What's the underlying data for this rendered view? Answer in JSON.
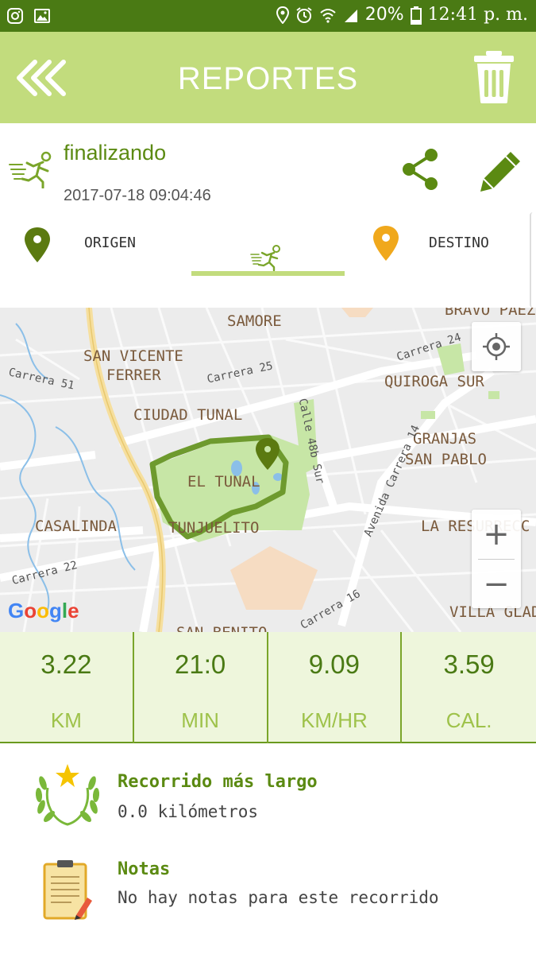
{
  "status_bar": {
    "battery": "20%",
    "time": "12:41 p. m."
  },
  "header": {
    "title": "REPORTES"
  },
  "session": {
    "name": "finalizando",
    "datetime": "2017-07-18 09:04:46"
  },
  "tabs": {
    "origin": "ORIGEN",
    "destination": "DESTINO"
  },
  "map": {
    "labels": {
      "samore": "SAMORE",
      "bravo_paez": "BRAVO PAEZ",
      "san_vicente": "SAN VICENTE",
      "ferrer": "FERRER",
      "carrera25": "Carrera 25",
      "carrera24": "Carrera 24",
      "carrera51": "Carrera 51",
      "quiroga_sur": "QUIROGA SUR",
      "ciudad_tunal": "CIUDAD TUNAL",
      "calle48b": "Calle 48b Sur",
      "granjas": "GRANJAS",
      "san_pablo": "SAN PABLO",
      "el_tunal": "EL TUNAL",
      "avenida_carrera14": "Avenida Carrera 14",
      "casalinda": "CASALINDA",
      "tunjuelito": "TUNJUELITO",
      "la_resurreccion": "LA RESURRECC",
      "carrera22": "Carrera 22",
      "carrera16": "Carrera 16",
      "san_benito": "SAN BENITO",
      "villa_gladys": "VILLA GLAD"
    },
    "zoom_in": "+",
    "zoom_out": "−",
    "attribution": "Google"
  },
  "stats": [
    {
      "value": "3.22",
      "unit": "KM"
    },
    {
      "value": "21:0",
      "unit": "MIN"
    },
    {
      "value": "9.09",
      "unit": "KM/HR"
    },
    {
      "value": "3.59",
      "unit": "CAL."
    }
  ],
  "longest": {
    "title": "Recorrido más largo",
    "value": "0.0 kilómetros"
  },
  "notes": {
    "title": "Notas",
    "value": "No hay notas para este recorrido"
  },
  "colors": {
    "header_bg": "#c2dc7d",
    "status_bg": "#4a7a14",
    "accent": "#5b8a12"
  }
}
